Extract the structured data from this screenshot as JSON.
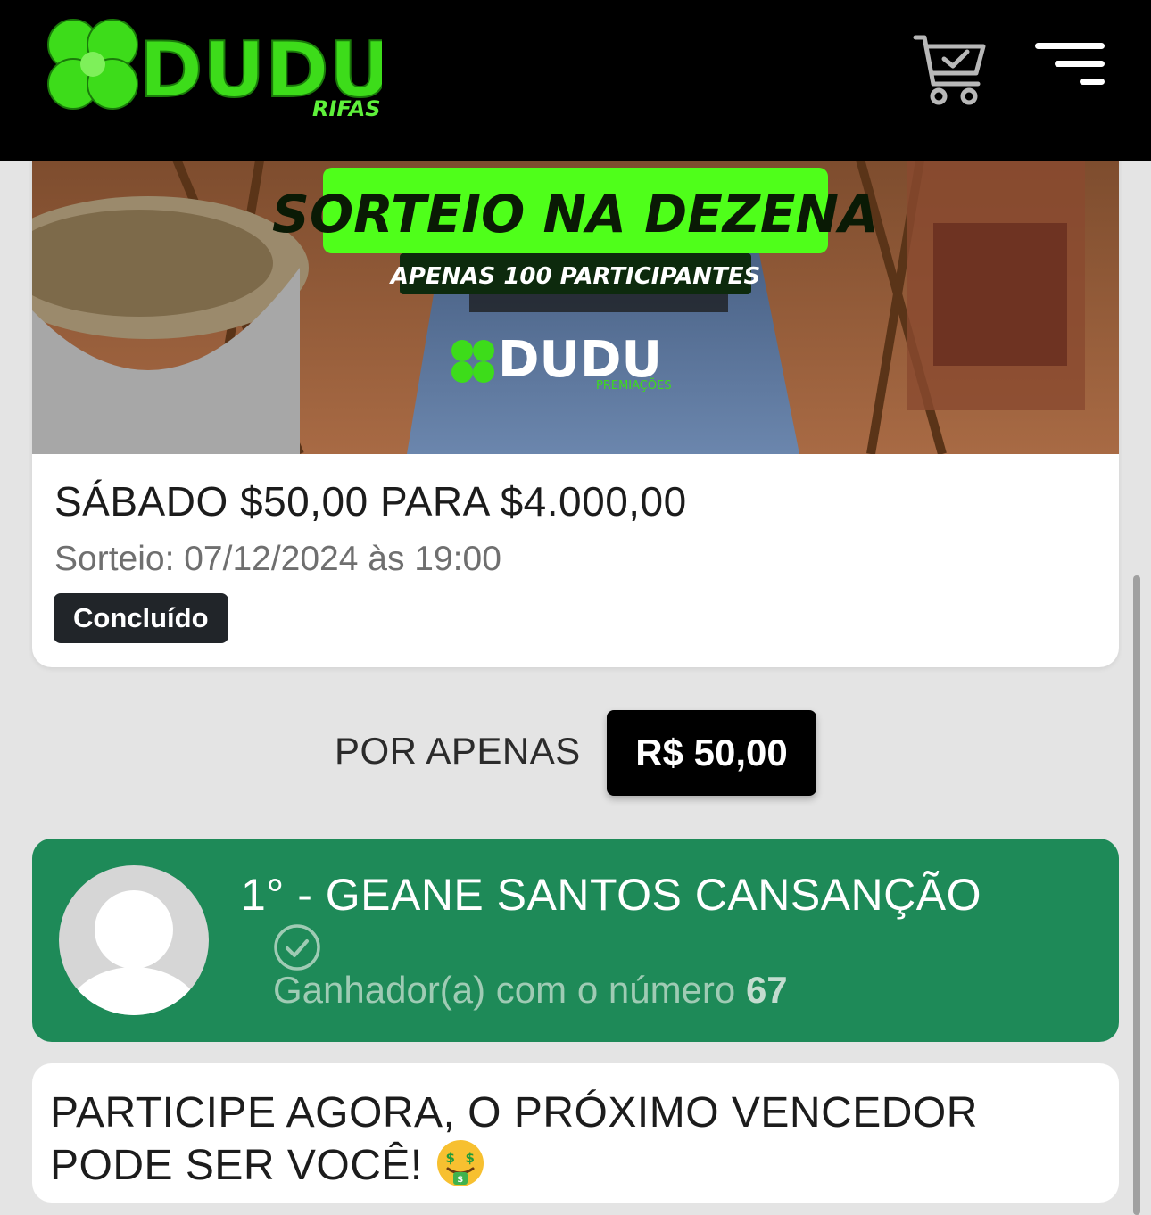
{
  "header": {
    "logo_text": "DUDU",
    "logo_subtext": "RIFAS",
    "cart_icon": "cart-check-icon",
    "menu_icon": "menu-icon"
  },
  "raffle": {
    "banner": {
      "headline": "SORTEIO NA DEZENA",
      "subheadline": "APENAS 100 PARTICIPANTES",
      "brand": "DUDU",
      "brand_sub": "PREMIAÇÕES"
    },
    "title": "SÁBADO $50,00 PARA $4.000,00",
    "date": "Sorteio: 07/12/2024 às 19:00",
    "status": "Concluído"
  },
  "price": {
    "label": "POR APENAS",
    "value": "R$ 50,00"
  },
  "winner": {
    "name": "1° - GEANE SANTOS CANSANÇÃO",
    "number_label": "Ganhador(a) com o número",
    "number": "67",
    "verified_icon": "check-circle-icon"
  },
  "cta": {
    "text": "PARTICIPE AGORA, O PRÓXIMO VENCEDOR PODE SER VOCÊ!",
    "emoji": "money-mouth-face-icon"
  },
  "colors": {
    "header_bg": "#000000",
    "logo_green": "#3ddc1a",
    "winner_bg": "#1e8a58",
    "badge_bg": "#212529",
    "page_bg": "#e4e4e4"
  }
}
